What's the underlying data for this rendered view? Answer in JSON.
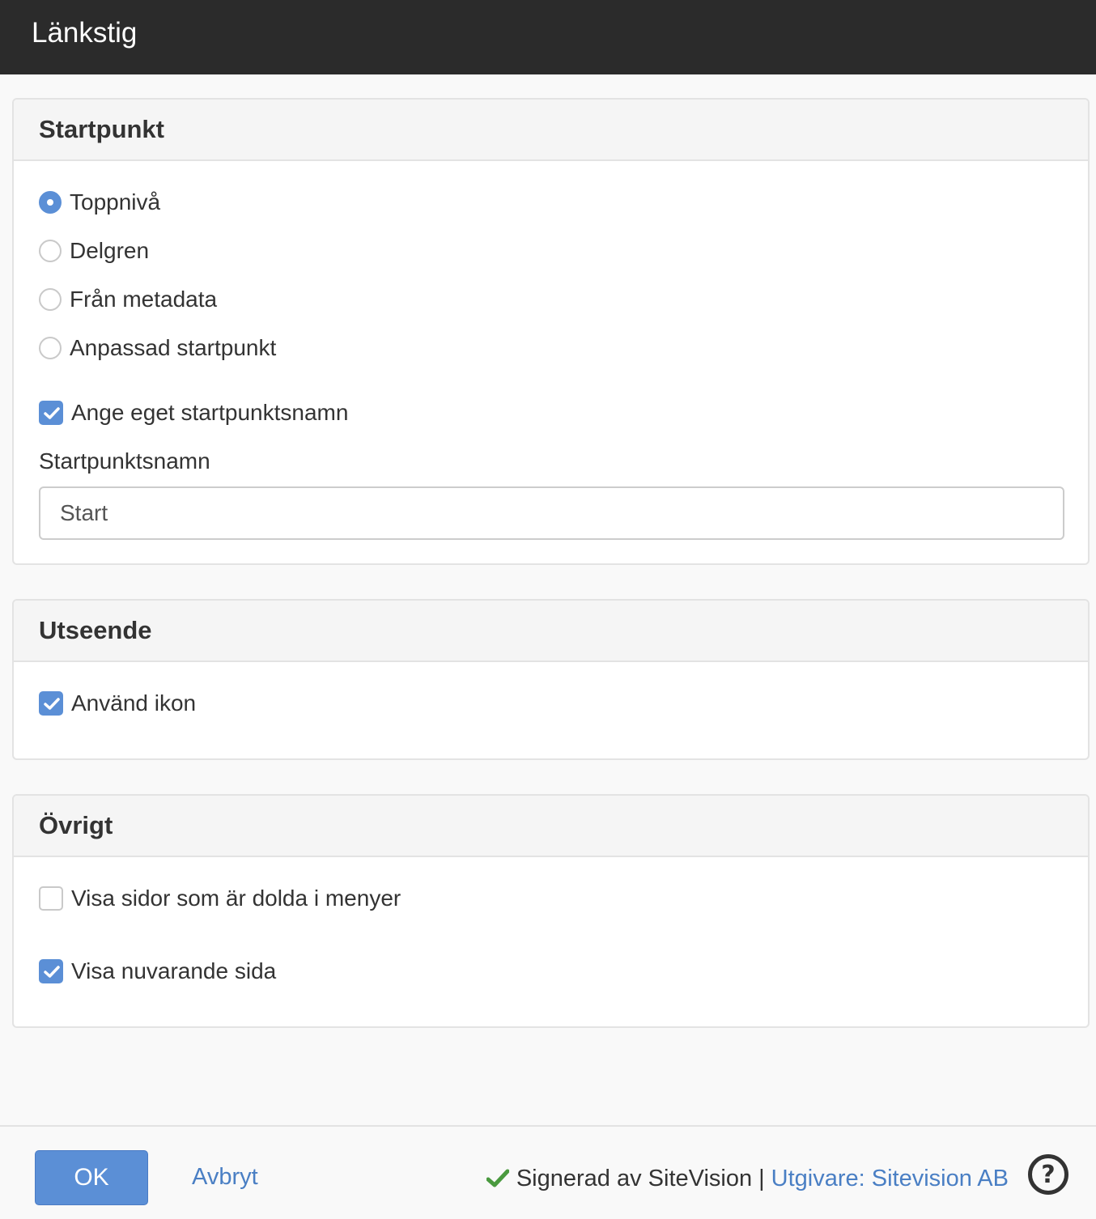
{
  "window": {
    "title": "Länkstig"
  },
  "startpoint": {
    "heading": "Startpunkt",
    "options": [
      {
        "label": "Toppnivå",
        "checked": true
      },
      {
        "label": "Delgren",
        "checked": false
      },
      {
        "label": "Från metadata",
        "checked": false
      },
      {
        "label": "Anpassad startpunkt",
        "checked": false
      }
    ],
    "custom_name_checkbox": {
      "label": "Ange eget startpunktsnamn",
      "checked": true
    },
    "name_field": {
      "label": "Startpunktsnamn",
      "value": "Start"
    }
  },
  "appearance": {
    "heading": "Utseende",
    "use_icon": {
      "label": "Använd ikon",
      "checked": true
    }
  },
  "other": {
    "heading": "Övrigt",
    "show_hidden": {
      "label": "Visa sidor som är dolda i menyer",
      "checked": false
    },
    "show_current": {
      "label": "Visa nuvarande sida",
      "checked": true
    }
  },
  "footer": {
    "ok_label": "OK",
    "cancel_label": "Avbryt",
    "signed_text": "Signerad av SiteVision",
    "separator": "|",
    "publisher_text": "Utgivare: Sitevision AB",
    "help_symbol": "?"
  },
  "colors": {
    "accent": "#5b8fd6",
    "link": "#4a7fc4",
    "header_bg": "#2b2b2b",
    "check_green": "#4a9a3f"
  }
}
